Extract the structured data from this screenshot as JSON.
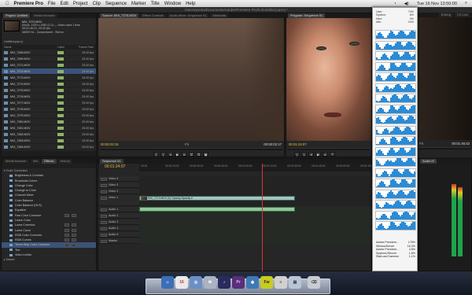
{
  "menubar": {
    "items": [
      "Premiere Pro",
      "File",
      "Edit",
      "Project",
      "Clip",
      "Sequence",
      "Marker",
      "Title",
      "Window",
      "Help"
    ],
    "clock": "Tue 16 Nov  13:50:00"
  },
  "titlebar": {
    "path": "/Users/yuuka/Documents/Adobe/Premiere Pro/5.0/untitled.prproj *"
  },
  "project": {
    "tabs": [
      "Project: Untitled",
      "Media Browser"
    ],
    "info_name": "MVI_7272.MOV",
    "info_lines": [
      "Movie, 1920 x 1080 (1.0) — Video used 1 time",
      "00:01:46:21, 25.00 fps",
      "48000 Hz - Compressed - Stereo"
    ],
    "file_name": "Untitled.prproj",
    "headers": {
      "name": "Name",
      "label": "Label",
      "frame_rate": "Frame Rate"
    },
    "rows": [
      {
        "name": "MVI_7268.MOV",
        "fps": "25.00 fps"
      },
      {
        "name": "MVI_7269.MOV",
        "fps": "25.00 fps"
      },
      {
        "name": "MVI_7271.MOV",
        "fps": "25.00 fps"
      },
      {
        "name": "MVI_7272.MOV",
        "fps": "25.00 fps"
      },
      {
        "name": "MVI_7273.MOV",
        "fps": "25.00 fps"
      },
      {
        "name": "MVI_7274.MOV",
        "fps": "25.00 fps"
      },
      {
        "name": "MVI_7275.MOV",
        "fps": "25.00 fps"
      },
      {
        "name": "MVI_7276.MOV",
        "fps": "25.00 fps"
      },
      {
        "name": "MVI_7277.MOV",
        "fps": "25.00 fps"
      },
      {
        "name": "MVI_7278.MOV",
        "fps": "25.00 fps"
      },
      {
        "name": "MVI_7279.MOV",
        "fps": "25.00 fps"
      },
      {
        "name": "MVI_7280.MOV",
        "fps": "25.00 fps"
      },
      {
        "name": "MVI_7281.MOV",
        "fps": "25.00 fps"
      },
      {
        "name": "MVI_7282.MOV",
        "fps": "25.00 fps"
      },
      {
        "name": "MVI_7283.MOV",
        "fps": "25.00 fps"
      },
      {
        "name": "MVI_7284.MOV",
        "fps": "25.00 fps"
      }
    ]
  },
  "source": {
    "tabs": [
      "Source: MVI_7275.MOV",
      "Effect Controls",
      "Audio Mixer: Sequence 01",
      "Metadata"
    ],
    "timecode_in": "00:00:02:15",
    "zoom": "Fit",
    "timecode_out": "00:00:02:17"
  },
  "program": {
    "tabs": [
      "Program: Sequence 01"
    ],
    "timecode": "00:01:24:07",
    "duration": "00:01:46:42"
  },
  "right": {
    "fit": "Fit",
    "duration": "00:01:46:42",
    "workspace": "Editing",
    "search": "CS Live"
  },
  "activity": {
    "stats": [
      {
        "k": "User:",
        "v": "70%"
      },
      {
        "k": "System:",
        "v": "6%"
      },
      {
        "k": "Nice:",
        "v": "0%"
      },
      {
        "k": "Idle:",
        "v": "24%"
      }
    ],
    "processes": [
      {
        "k": "Adobe Premiere…",
        "v": "175%"
      },
      {
        "k": "WindowServer",
        "v": "16.3%"
      },
      {
        "k": "Adobe Premiere…",
        "v": "4.8%"
      },
      {
        "k": "SystemUIServer",
        "v": "1.8%"
      },
      {
        "k": "StatLoad Daemon",
        "v": "1.1%"
      }
    ]
  },
  "effects": {
    "tabs": [
      "Media Browser",
      "Info",
      "Effects",
      "History"
    ],
    "folder": "Color Correction",
    "items": [
      "Brightness & Contrast",
      "Broadcast Colors",
      "Change Color",
      "Change to Color",
      "Channel Mixer",
      "Color Balance",
      "Color Balance (HLS)",
      "Equalize",
      "Fast Color Corrector",
      "Leave Color",
      "Luma Corrector",
      "Luma Curve",
      "RGB Color Corrector",
      "RGB Curves",
      "Three-Way Color Corrector",
      "Tint",
      "Video Limiter"
    ],
    "footer_folder": "Distort"
  },
  "timeline": {
    "tabs": [
      "Sequence 01"
    ],
    "timecode": "00:01:24:07",
    "ruler": [
      "00:00",
      "00:00:15:00",
      "00:00:30:00",
      "00:00:45:00",
      "00:01:00:00",
      "00:01:15:00",
      "00:01:30:00",
      "00:01:45:00",
      "00:02:00:00",
      "00:02:15:00"
    ],
    "video_tracks": [
      "Video 4",
      "Video 3",
      "Video 2",
      "Video 1"
    ],
    "audio_tracks": [
      "Audio 1",
      "Audio 2",
      "Audio 3",
      "Audio 4",
      "Audio 5",
      "Master"
    ],
    "clip_label": "MVI_7272.MOV [V] Opacity:Opacity ▾"
  },
  "audio_meters": {
    "tab": "Audio M"
  }
}
